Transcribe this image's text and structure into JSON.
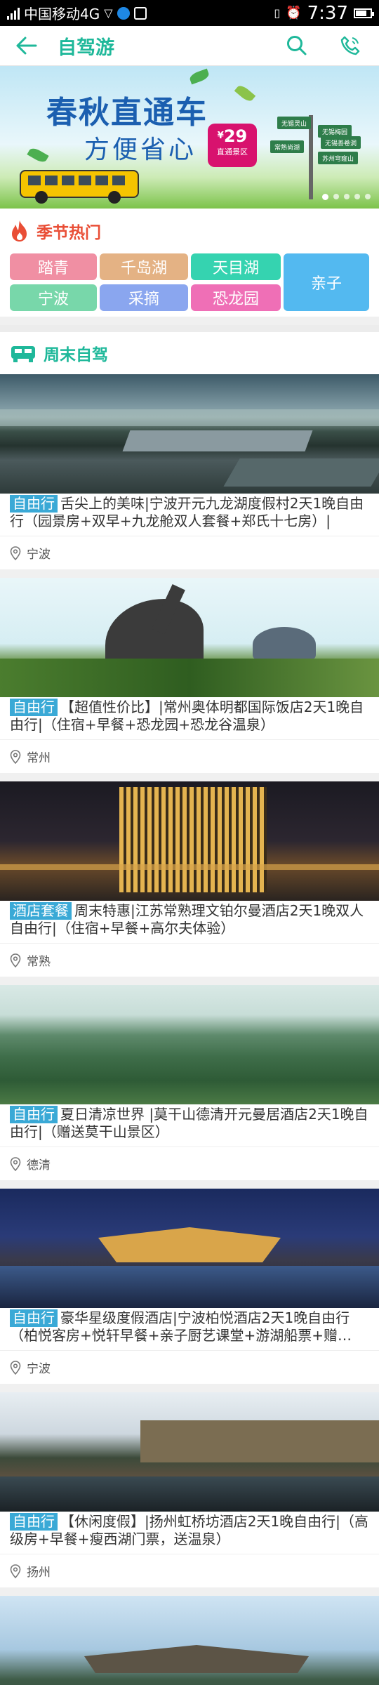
{
  "status_bar": {
    "carrier": "中国移动4G",
    "time": "7:37"
  },
  "header": {
    "title": "自驾游"
  },
  "banner": {
    "title": "春秋直通车",
    "subtitle": "方便省心",
    "price_symbol": "¥",
    "price": "29",
    "price_label": "直通景区",
    "signs": [
      "无锡灵山",
      "无锡梅园",
      "常熟尚湖",
      "苏州穹窿山",
      "无锡善卷洞"
    ]
  },
  "season": {
    "title": "季节热门",
    "tags": [
      {
        "label": "踏青",
        "color": "#f08fa3"
      },
      {
        "label": "千岛湖",
        "color": "#e4b284"
      },
      {
        "label": "天目湖",
        "color": "#35d3b0"
      },
      {
        "label": "亲子",
        "color": "#53b9f0"
      },
      {
        "label": "宁波",
        "color": "#78d7aa"
      },
      {
        "label": "采摘",
        "color": "#8aa6ef"
      },
      {
        "label": "恐龙园",
        "color": "#ef6fb6"
      }
    ]
  },
  "weekend": {
    "title": "周末自驾",
    "cards": [
      {
        "badge": "自由行",
        "text": "舌尖上的美味|宁波开元九龙湖度假村2天1晚自由行（园景房+双早+九龙舱双人套餐+郑氏十七房）|",
        "location": "宁波"
      },
      {
        "badge": "自由行",
        "text": "【超值性价比】|常州奥体明都国际饭店2天1晚自由行|（住宿+早餐+恐龙园+恐龙谷温泉）",
        "location": "常州"
      },
      {
        "badge": "酒店套餐",
        "text": "周末特惠|江苏常熟理文铂尔曼酒店2天1晚双人自由行|（住宿+早餐+高尔夫体验）",
        "location": "常熟"
      },
      {
        "badge": "自由行",
        "text": "夏日清凉世界 |莫干山德清开元曼居酒店2天1晚自由行|（赠送莫干山景区）",
        "location": "德清"
      },
      {
        "badge": "自由行",
        "text": "豪华星级度假酒店|宁波柏悦酒店2天1晚自由行（柏悦客房+悦轩早餐+亲子厨艺课堂+游湖船票+赠…",
        "location": "宁波"
      },
      {
        "badge": "自由行",
        "text": "【休闲度假】|扬州虹桥坊酒店2天1晚自由行|（高级房+早餐+瘦西湖门票，送温泉）",
        "location": "扬州"
      }
    ]
  },
  "colors": {
    "accent": "#1fb89a",
    "hot": "#e94e36",
    "badge": "#3aa9d6"
  },
  "icons": [
    "back-arrow-icon",
    "search-icon",
    "phone-icon",
    "fire-icon",
    "car-icon",
    "location-pin-icon"
  ]
}
